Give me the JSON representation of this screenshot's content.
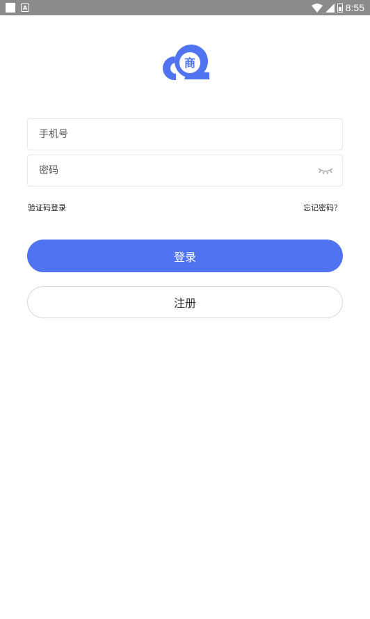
{
  "status_bar": {
    "time": "8:55",
    "left_icons": [
      "notification-square-icon",
      "text-a-icon"
    ],
    "right_icons": [
      "wifi-icon",
      "cell-signal-icon",
      "battery-icon"
    ]
  },
  "logo": {
    "glyph": "商",
    "color": "#4f73f1"
  },
  "form": {
    "phone_placeholder": "手机号",
    "password_placeholder": "密码",
    "sms_login_label": "验证码登录",
    "forgot_password_label": "忘记密码？"
  },
  "buttons": {
    "login_label": "登录",
    "register_label": "注册"
  },
  "colors": {
    "primary": "#4f73f1",
    "status_bar": "#8a8a8a"
  }
}
